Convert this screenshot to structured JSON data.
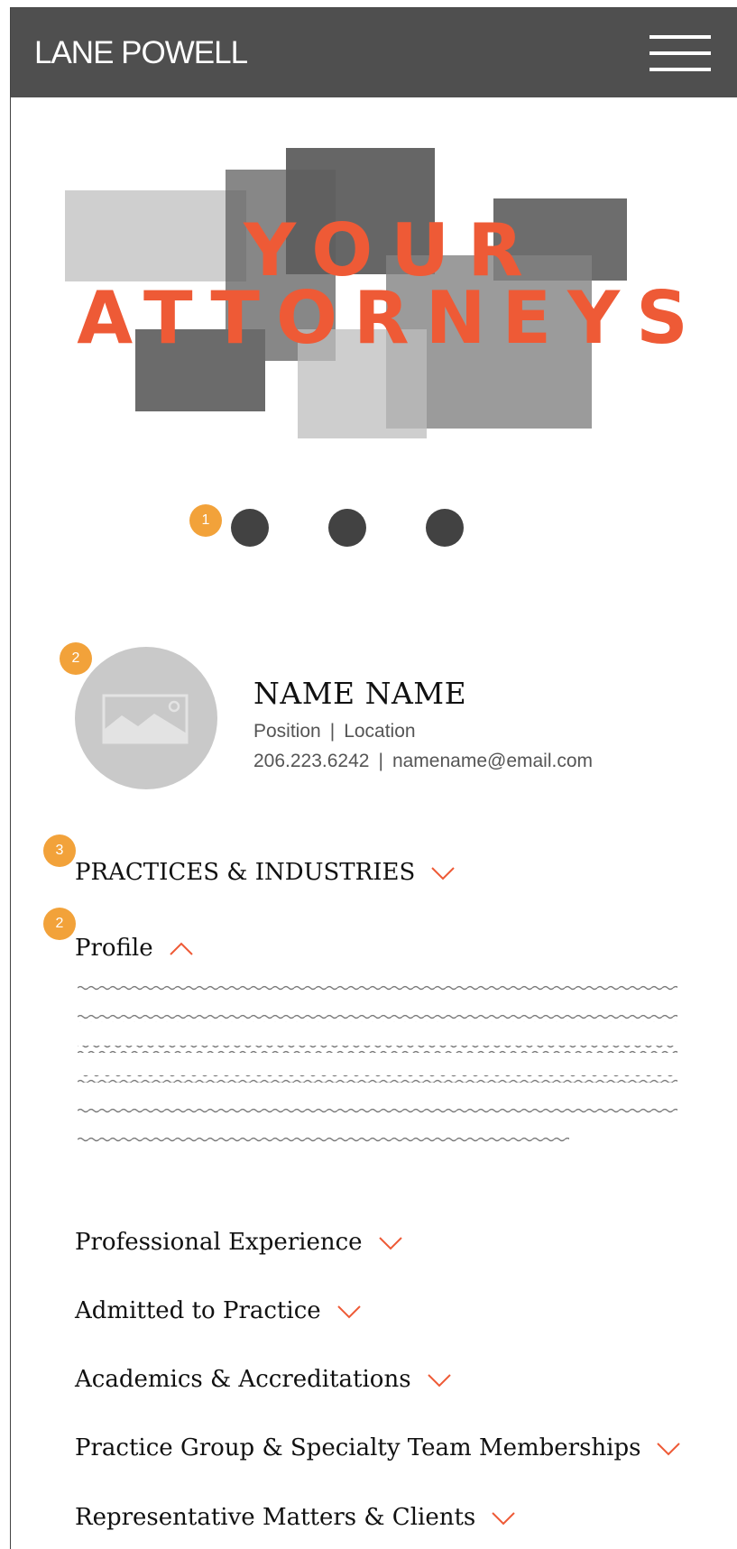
{
  "header": {
    "logo": "LANE POWELL",
    "menu_icon": "hamburger-icon"
  },
  "hero": {
    "line1": "YOUR",
    "line2": "ATTORNEYS",
    "title_color": "#ee5a36"
  },
  "annotations": {
    "carousel_badge": "1",
    "avatar_badge": "2",
    "practices_badge": "3",
    "profile_badge": "2",
    "badge_color": "#f2a23a"
  },
  "carousel": {
    "dot_count": 3
  },
  "attorney": {
    "name": "NAME NAME",
    "position": "Position",
    "location": "Location",
    "phone": "206.223.6242",
    "email": "namename@email.com",
    "separator": "|",
    "avatar_icon": "image-placeholder-icon"
  },
  "sections": {
    "practices": "PRACTICES & INDUSTRIES",
    "profile": "Profile",
    "professional_experience": "Professional Experience",
    "admitted": "Admitted to Practice",
    "academics": "Academics & Accreditations",
    "memberships": "Practice Group & Specialty Team Memberships",
    "matters": "Representative Matters & Clients"
  },
  "colors": {
    "header_bg": "#4f4f4f",
    "accent": "#ee5a36"
  }
}
